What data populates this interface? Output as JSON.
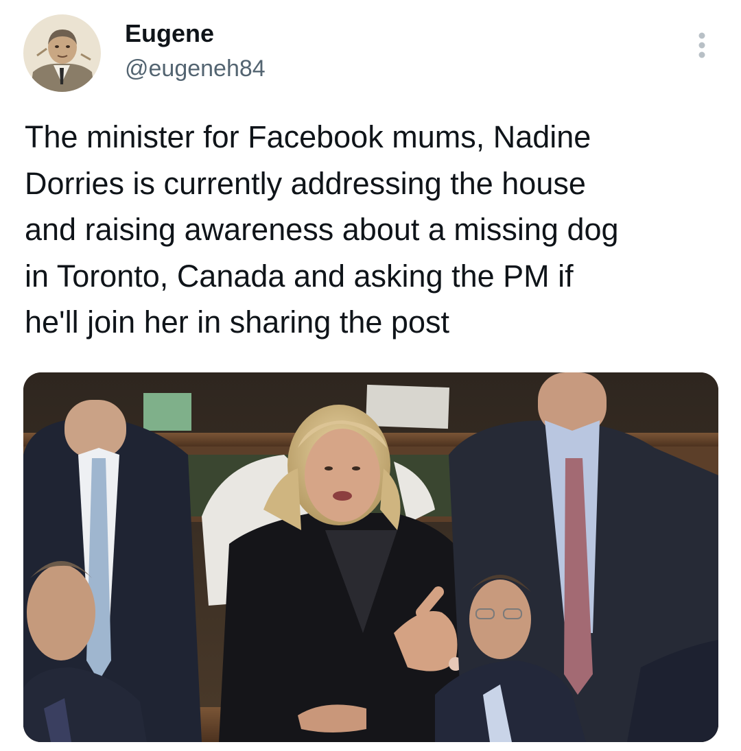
{
  "author": {
    "display_name": "Eugene",
    "handle": "@eugeneh84",
    "avatar_icon": "caricature-portrait-avatar"
  },
  "menu": {
    "icon": "more-vertical-icon"
  },
  "tweet": {
    "text": "The minister for Facebook mums, Nadine\nDorries is currently addressing the house\nand raising awareness about a missing dog\nin Toronto, Canada and asking the PM if\nhe'll join her in sharing the post"
  },
  "media": {
    "kind": "photo",
    "colors": {
      "bench_wood": "#6b4a30",
      "dark_suit": "#1f2433",
      "blonde_hair": "#d9c08c"
    }
  },
  "colors": {
    "text_primary": "#0f1419",
    "text_secondary": "#536471",
    "background": "#ffffff"
  }
}
